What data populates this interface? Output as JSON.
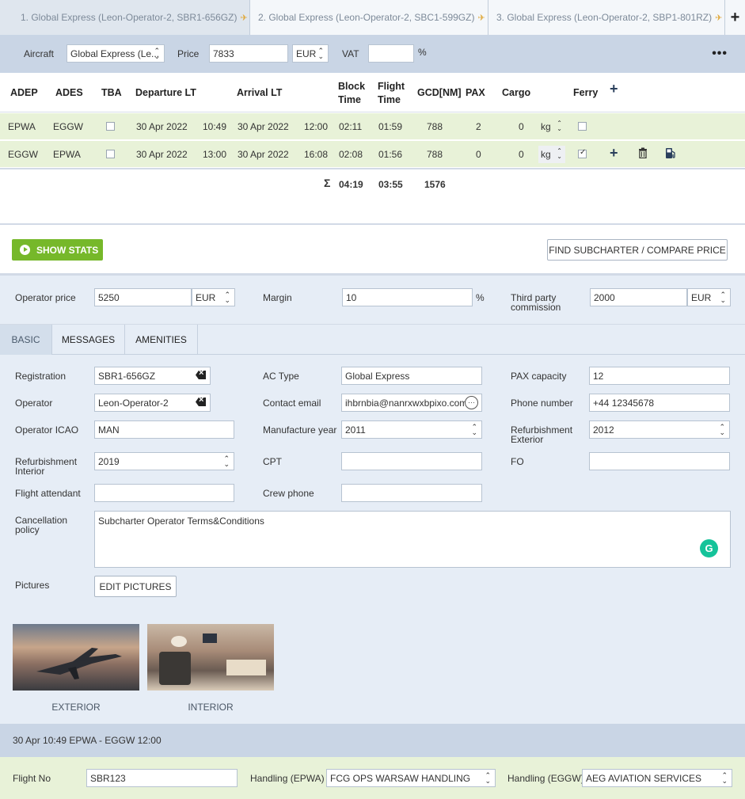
{
  "tabs": [
    {
      "label": "1. Global Express (Leon-Operator-2, SBR1-656GZ)"
    },
    {
      "label": "2. Global Express (Leon-Operator-2, SBC1-599GZ)"
    },
    {
      "label": "3. Global Express (Leon-Operator-2, SBP1-801RZ)"
    }
  ],
  "tab_add": "+",
  "aircraft_bar": {
    "aircraft_label": "Aircraft",
    "aircraft_value": "Global Express (Le...",
    "price_label": "Price",
    "price_value": "7833",
    "currency": "EUR",
    "vat_label": "VAT",
    "vat_value": "",
    "vat_unit": "%",
    "more": "•••"
  },
  "legs_header": {
    "adep": "ADEP",
    "ades": "ADES",
    "tba": "TBA",
    "departure": "Departure LT",
    "arrival": "Arrival LT",
    "block_time_1": "Block",
    "block_time_2": "Time",
    "flight_time_1": "Flight",
    "flight_time_2": "Time",
    "gcd": "GCD[NM]",
    "pax": "PAX",
    "cargo": "Cargo",
    "ferry": "Ferry",
    "add": "+"
  },
  "legs": [
    {
      "adep": "EPWA",
      "ades": "EGGW",
      "tba": false,
      "dep_date": "30 Apr 2022",
      "dep_time": "10:49",
      "arr_date": "30 Apr 2022",
      "arr_time": "12:00",
      "block": "02:11",
      "flight": "01:59",
      "gcd": "788",
      "pax": "2",
      "cargo": "0",
      "unit": "kg",
      "ferry": false
    },
    {
      "adep": "EGGW",
      "ades": "EPWA",
      "tba": false,
      "dep_date": "30 Apr 2022",
      "dep_time": "13:00",
      "arr_date": "30 Apr 2022",
      "arr_time": "16:08",
      "block": "02:08",
      "flight": "01:56",
      "gcd": "788",
      "pax": "0",
      "cargo": "0",
      "unit": "kg",
      "ferry": true
    }
  ],
  "totals": {
    "sigma": "Σ",
    "block": "04:19",
    "flight": "03:55",
    "gcd": "1576"
  },
  "stats": {
    "show_stats": "SHOW STATS",
    "find_subcharter": "FIND SUBCHARTER / COMPARE PRICE"
  },
  "pricing": {
    "operator_price_label": "Operator price",
    "operator_price": "5250",
    "operator_currency": "EUR",
    "margin_label": "Margin",
    "margin": "10",
    "margin_unit": "%",
    "third_party_label_1": "Third party",
    "third_party_label_2": "commission",
    "third_party": "2000",
    "third_party_currency": "EUR"
  },
  "subtabs": [
    "BASIC",
    "MESSAGES",
    "AMENITIES"
  ],
  "basic": {
    "registration_label": "Registration",
    "registration": "SBR1-656GZ",
    "ac_type_label": "AC Type",
    "ac_type": "Global Express",
    "pax_capacity_label": "PAX capacity",
    "pax_capacity": "12",
    "operator_label": "Operator",
    "operator": "Leon-Operator-2",
    "contact_email_label": "Contact email",
    "contact_email": "ihbrnbia@nanrxwxbpixo.com",
    "phone_label": "Phone number",
    "phone": "+44 12345678",
    "operator_icao_label": "Operator ICAO",
    "operator_icao": "MAN",
    "manufacture_year_label": "Manufacture year",
    "manufacture_year": "2011",
    "refurb_ext_label_1": "Refurbishment",
    "refurb_ext_label_2": "Exterior",
    "refurb_ext": "2012",
    "refurb_int_label_1": "Refurbishment",
    "refurb_int_label_2": "Interior",
    "refurb_int": "2019",
    "cpt_label": "CPT",
    "cpt": "",
    "fo_label": "FO",
    "fo": "",
    "attendant_label": "Flight attendant",
    "attendant": "",
    "crew_phone_label": "Crew phone",
    "crew_phone": "",
    "cancellation_label_1": "Cancellation",
    "cancellation_label_2": "policy",
    "cancellation": "Subcharter Operator Terms&Conditions",
    "pictures_label": "Pictures",
    "edit_pictures": "EDIT PICTURES",
    "exterior_label": "EXTERIOR",
    "interior_label": "INTERIOR"
  },
  "leg_section": {
    "title": "30 Apr 10:49 EPWA - EGGW 12:00",
    "flight_no_label": "Flight No",
    "flight_no": "SBR123",
    "handling_dep_label": "Handling (EPWA)",
    "handling_dep": "FCG OPS WARSAW HANDLING",
    "handling_arr_label": "Handling (EGGW)",
    "handling_arr": "AEG AVIATION SERVICES"
  }
}
